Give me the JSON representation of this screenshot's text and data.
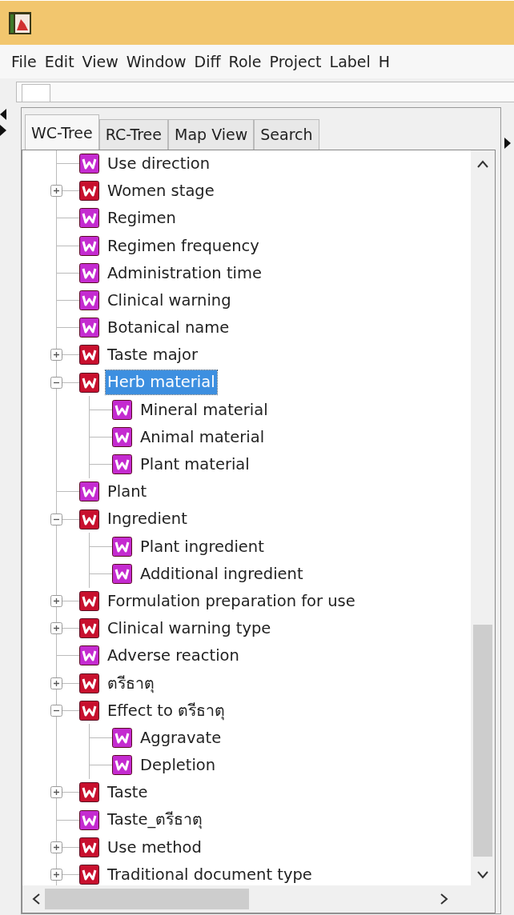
{
  "menu": [
    "File",
    "Edit",
    "View",
    "Window",
    "Diff",
    "Role",
    "Project",
    "Label",
    "H"
  ],
  "tabs": [
    {
      "label": "WC-Tree",
      "selected": true
    },
    {
      "label": "RC-Tree",
      "selected": false
    },
    {
      "label": "Map View",
      "selected": false
    },
    {
      "label": "Search",
      "selected": false
    }
  ],
  "tree": {
    "items": [
      {
        "label": "Use direction",
        "kind": "leaf",
        "selected": false
      },
      {
        "label": "Women stage",
        "kind": "branch",
        "expanded": false,
        "selected": false
      },
      {
        "label": "Regimen",
        "kind": "leaf",
        "selected": false
      },
      {
        "label": "Regimen frequency",
        "kind": "leaf",
        "selected": false
      },
      {
        "label": "Administration time",
        "kind": "leaf",
        "selected": false
      },
      {
        "label": "Clinical warning",
        "kind": "leaf",
        "selected": false
      },
      {
        "label": "Botanical name",
        "kind": "leaf",
        "selected": false
      },
      {
        "label": "Taste major",
        "kind": "branch",
        "expanded": false,
        "selected": false
      },
      {
        "label": "Herb material",
        "kind": "branch",
        "expanded": true,
        "selected": true,
        "children": [
          {
            "label": "Mineral material",
            "kind": "leaf",
            "selected": false
          },
          {
            "label": "Animal material",
            "kind": "leaf",
            "selected": false
          },
          {
            "label": "Plant material",
            "kind": "leaf",
            "selected": false
          }
        ]
      },
      {
        "label": "Plant",
        "kind": "leaf",
        "selected": false
      },
      {
        "label": "Ingredient",
        "kind": "branch",
        "expanded": true,
        "selected": false,
        "children": [
          {
            "label": "Plant ingredient",
            "kind": "leaf",
            "selected": false
          },
          {
            "label": "Additional ingredient",
            "kind": "leaf",
            "selected": false
          }
        ]
      },
      {
        "label": "Formulation preparation for use",
        "kind": "branch",
        "expanded": false,
        "selected": false
      },
      {
        "label": "Clinical warning type",
        "kind": "branch",
        "expanded": false,
        "selected": false
      },
      {
        "label": "Adverse reaction",
        "kind": "leaf",
        "selected": false
      },
      {
        "label": "ตรีธาตุ",
        "kind": "branch",
        "expanded": false,
        "selected": false
      },
      {
        "label": "Effect to ตรีธาตุ",
        "kind": "branch",
        "expanded": true,
        "selected": false,
        "children": [
          {
            "label": "Aggravate",
            "kind": "leaf",
            "selected": false
          },
          {
            "label": "Depletion",
            "kind": "leaf",
            "selected": false
          }
        ]
      },
      {
        "label": "Taste",
        "kind": "branch",
        "expanded": false,
        "selected": false
      },
      {
        "label": "Taste_ตรีธาตุ",
        "kind": "leaf",
        "selected": false
      },
      {
        "label": "Use method",
        "kind": "branch",
        "expanded": false,
        "selected": false
      },
      {
        "label": "Traditional document type",
        "kind": "branch",
        "expanded": false,
        "selected": false
      }
    ]
  }
}
